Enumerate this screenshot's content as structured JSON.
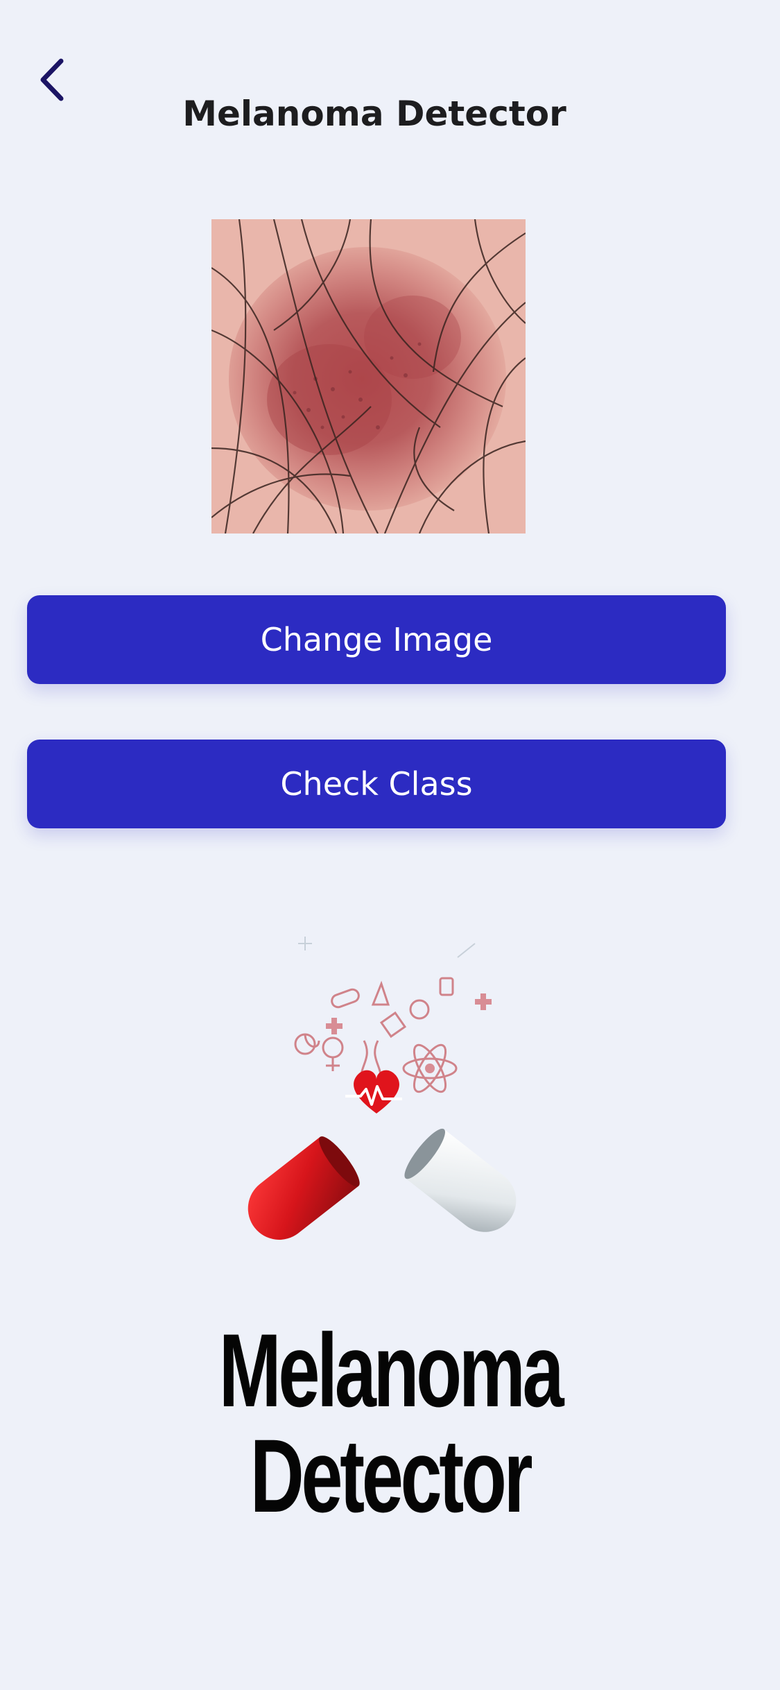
{
  "header": {
    "back_icon": "chevron-left-icon",
    "title": "Melanoma Detector"
  },
  "image_preview": {
    "subject": "dermoscopy skin lesion photo"
  },
  "actions": {
    "change_image_label": "Change Image",
    "check_class_label": "Check Class"
  },
  "branding": {
    "logo_icon": "capsule-medical-icons-logo",
    "line1": "Melanoma",
    "line2": "Detector"
  },
  "colors": {
    "background": "#eef1f9",
    "button": "#2c2bc2",
    "back_icon": "#1b1464",
    "capsule_red": "#d7151b",
    "capsule_white": "#e9eef1"
  }
}
